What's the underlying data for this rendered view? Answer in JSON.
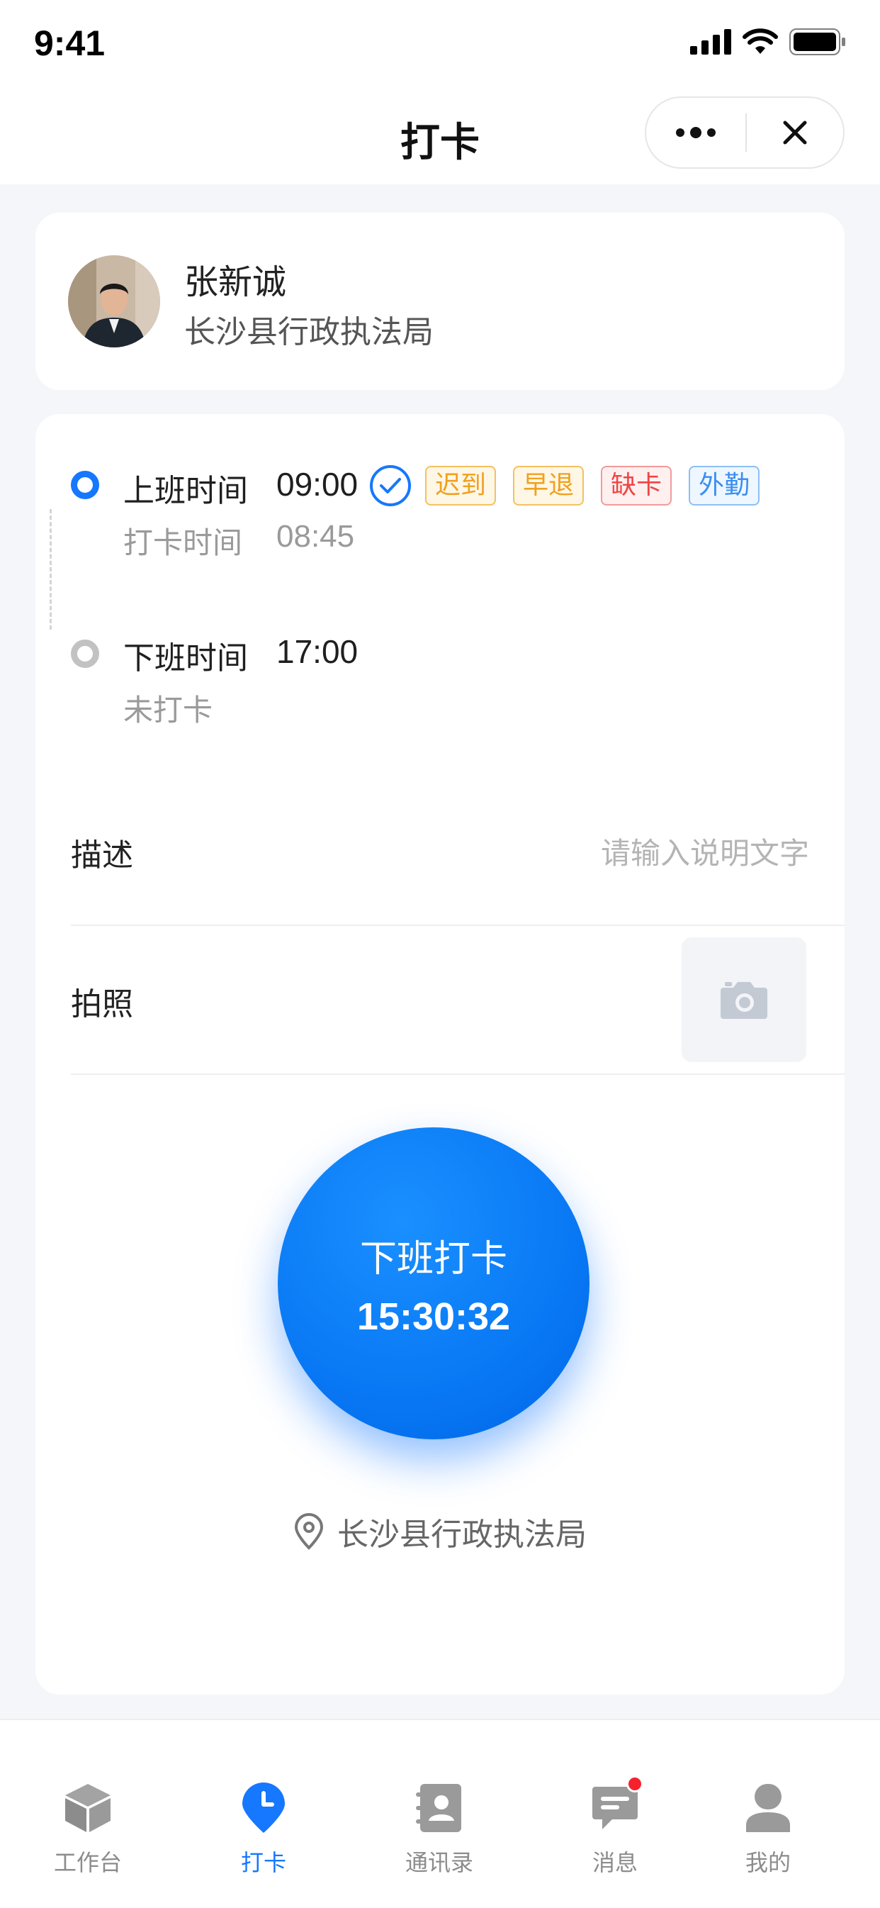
{
  "status_bar": {
    "time": "9:41"
  },
  "nav": {
    "title": "打卡"
  },
  "user": {
    "name": "张新诚",
    "department": "长沙县行政执法局"
  },
  "attendance": {
    "on_duty": {
      "label": "上班时间",
      "time": "09:00",
      "punch_label": "打卡时间",
      "punch_time": "08:45",
      "tags": [
        "迟到",
        "早退",
        "缺卡",
        "外勤"
      ]
    },
    "off_duty": {
      "label": "下班时间",
      "time": "17:00",
      "status": "未打卡"
    }
  },
  "form": {
    "description_label": "描述",
    "description_placeholder": "请输入说明文字",
    "photo_label": "拍照"
  },
  "clock_button": {
    "label": "下班打卡",
    "time": "15:30:32"
  },
  "location": {
    "text": "长沙县行政执法局"
  },
  "tabs": [
    {
      "label": "工作台",
      "icon": "cube-icon"
    },
    {
      "label": "打卡",
      "icon": "clock-pin-icon"
    },
    {
      "label": "通讯录",
      "icon": "contacts-icon"
    },
    {
      "label": "消息",
      "icon": "message-icon"
    },
    {
      "label": "我的",
      "icon": "user-icon"
    }
  ],
  "colors": {
    "primary": "#1677ff",
    "background": "#f4f6fa"
  }
}
